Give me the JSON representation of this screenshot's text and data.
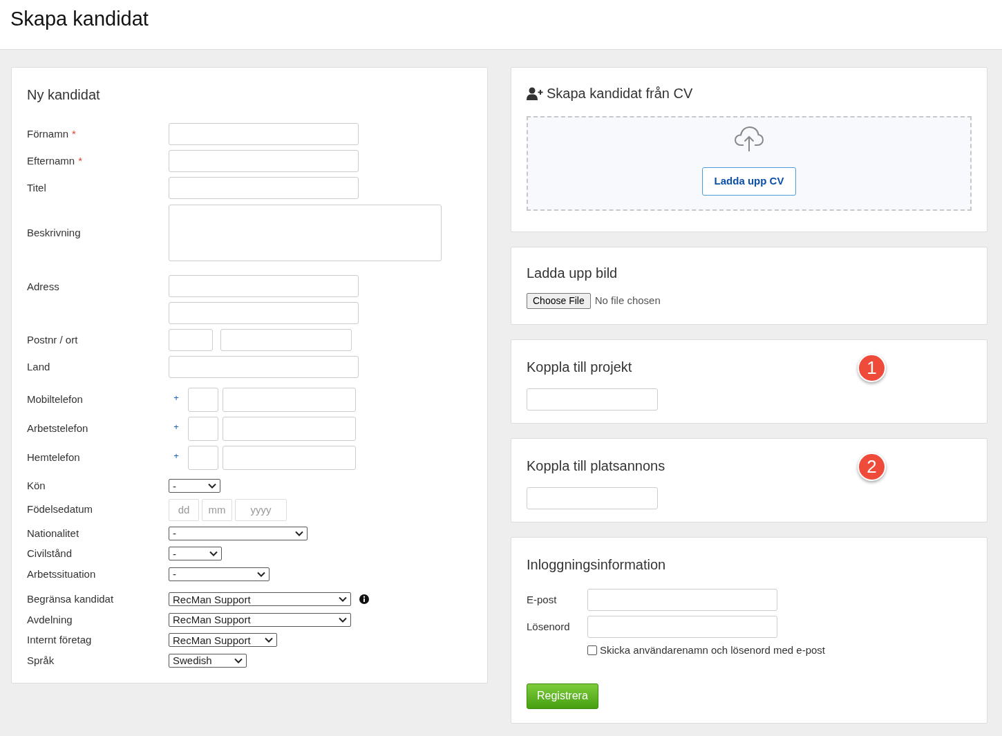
{
  "page_title": "Skapa kandidat",
  "new_candidate": {
    "title": "Ny kandidat",
    "rows": [
      {
        "label": "Förnamn",
        "required_mark": "*",
        "kind": "text"
      },
      {
        "label": "Efternamn",
        "required_mark": "*",
        "kind": "text"
      },
      {
        "label": "Titel",
        "kind": "text"
      },
      {
        "label": "Beskrivning",
        "kind": "textarea"
      },
      {
        "label": "Adress",
        "kind": "text2"
      },
      {
        "label": "Postnr / ort",
        "kind": "postal"
      },
      {
        "label": "Land",
        "kind": "text"
      },
      {
        "label": "Mobiltelefon",
        "kind": "phone",
        "prefix": "+"
      },
      {
        "label": "Arbetstelefon",
        "kind": "phone",
        "prefix": "+"
      },
      {
        "label": "Hemtelefon",
        "kind": "phone",
        "prefix": "+"
      },
      {
        "label": "Kön",
        "kind": "select",
        "value": "-"
      },
      {
        "label": "Födelsedatum",
        "kind": "date",
        "placeholders": [
          "dd",
          "mm",
          "yyyy"
        ]
      },
      {
        "label": "Nationalitet",
        "kind": "select",
        "value": "-"
      },
      {
        "label": "Civilstånd",
        "kind": "select",
        "value": "-"
      },
      {
        "label": "Arbetssituation",
        "kind": "select",
        "value": "-"
      },
      {
        "label": "Begränsa kandidat",
        "kind": "select",
        "value": "RecMan Support",
        "info": true
      },
      {
        "label": "Avdelning",
        "kind": "select",
        "value": "RecMan Support"
      },
      {
        "label": "Internt företag",
        "kind": "select",
        "value": "RecMan Support"
      },
      {
        "label": "Språk",
        "kind": "select",
        "value": "Swedish"
      }
    ]
  },
  "cv_card": {
    "title": "Skapa kandidat från CV",
    "button": "Ladda upp CV"
  },
  "picture_card": {
    "title": "Ladda upp bild",
    "file_button": "Choose File",
    "file_status": "No file chosen"
  },
  "project_card": {
    "title": "Koppla till projekt",
    "badge": "1"
  },
  "ad_card": {
    "title": "Koppla till platsannons",
    "badge": "2"
  },
  "login_card": {
    "title": "Inloggningsinformation",
    "fields": [
      {
        "label": "E-post"
      },
      {
        "label": "Lösenord"
      }
    ],
    "send_checkbox": {
      "label": "Skicka användarenamn och lösenord med e-post",
      "checked": false
    },
    "submit": "Registrera"
  }
}
